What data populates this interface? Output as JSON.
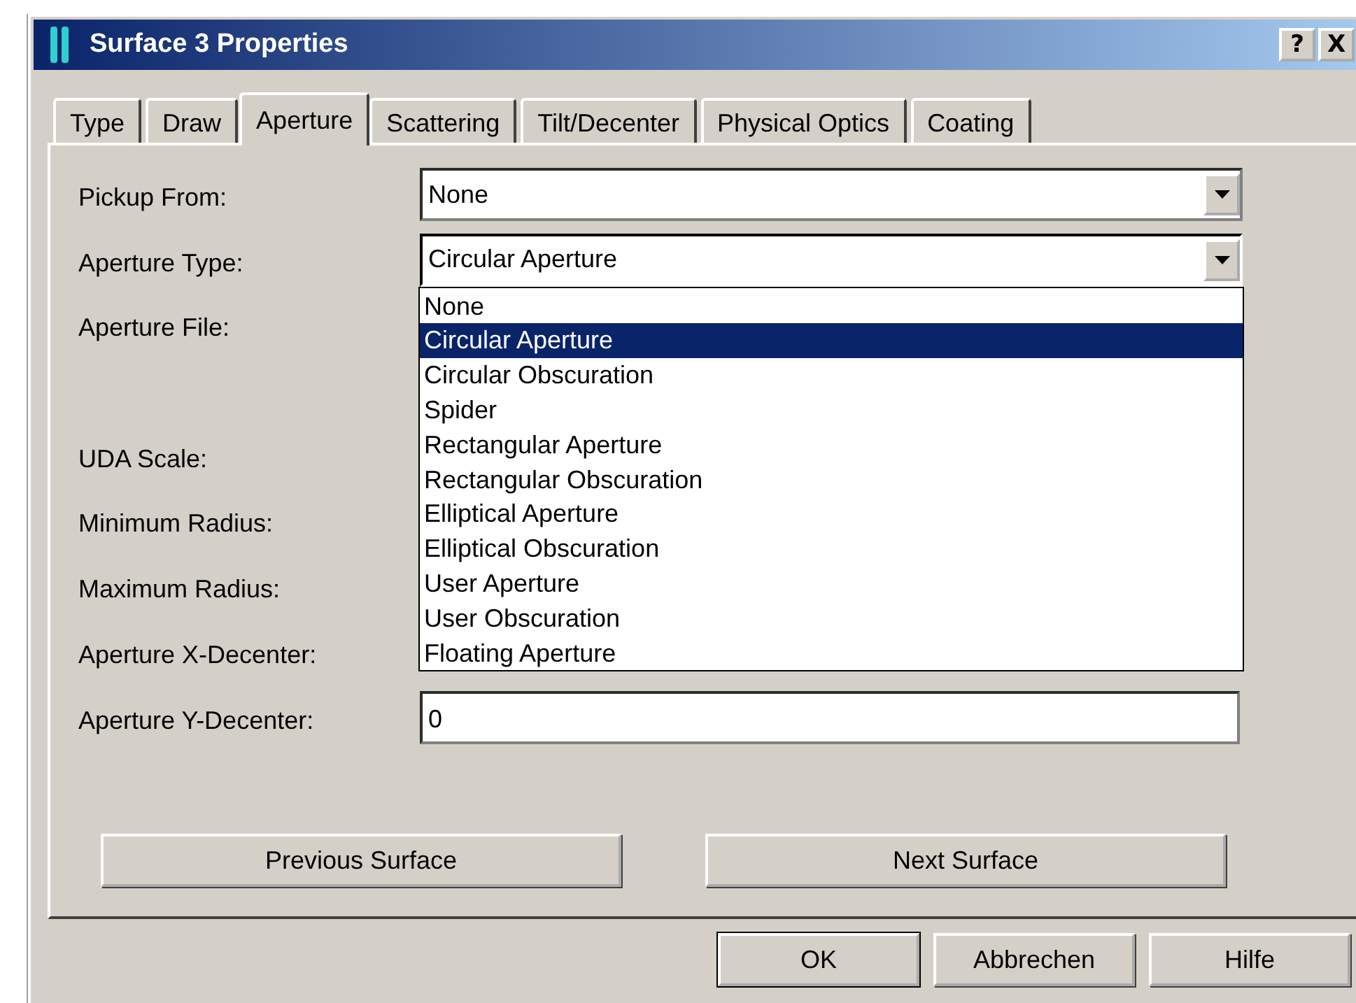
{
  "window": {
    "title": "Surface 3 Properties",
    "help_button": "?",
    "close_button": "X"
  },
  "tabs": [
    {
      "label": "Type",
      "selected": false
    },
    {
      "label": "Draw",
      "selected": false
    },
    {
      "label": "Aperture",
      "selected": true
    },
    {
      "label": "Scattering",
      "selected": false
    },
    {
      "label": "Tilt/Decenter",
      "selected": false
    },
    {
      "label": "Physical Optics",
      "selected": false
    },
    {
      "label": "Coating",
      "selected": false
    }
  ],
  "fields": [
    {
      "label": "Pickup From:",
      "kind": "combo",
      "value": "None",
      "expanded": false
    },
    {
      "label": "Aperture Type:",
      "kind": "combo",
      "value": "Circular Aperture",
      "expanded": true,
      "options": [
        {
          "label": "None",
          "selected": false
        },
        {
          "label": "Circular Aperture",
          "selected": true
        },
        {
          "label": "Circular Obscuration",
          "selected": false
        },
        {
          "label": "Spider",
          "selected": false
        },
        {
          "label": "Rectangular Aperture",
          "selected": false
        },
        {
          "label": "Rectangular Obscuration",
          "selected": false
        },
        {
          "label": "Elliptical Aperture",
          "selected": false
        },
        {
          "label": "Elliptical Obscuration",
          "selected": false
        },
        {
          "label": "User Aperture",
          "selected": false
        },
        {
          "label": "User Obscuration",
          "selected": false
        },
        {
          "label": "Floating Aperture",
          "selected": false
        }
      ]
    },
    {
      "label": "Aperture File:",
      "kind": "file"
    },
    {
      "label": "UDA Scale:",
      "kind": "covered"
    },
    {
      "label": "Minimum Radius:",
      "kind": "covered"
    },
    {
      "label": "Maximum Radius:",
      "kind": "covered"
    },
    {
      "label": "Aperture X-Decenter:",
      "kind": "covered"
    },
    {
      "label": "Aperture Y-Decenter:",
      "kind": "text",
      "value": "0"
    }
  ],
  "nav_buttons": [
    "Previous Surface",
    "Next Surface"
  ],
  "dialog_buttons": [
    {
      "label": "OK",
      "default": true
    },
    {
      "label": "Abbrechen",
      "default": false
    },
    {
      "label": "Hilfe",
      "default": false
    }
  ]
}
